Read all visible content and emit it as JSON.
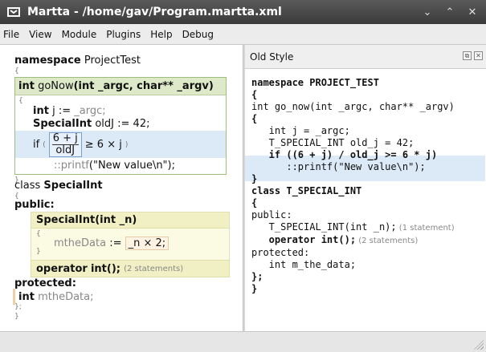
{
  "window": {
    "title": "Martta - /home/gav/Program.martta.xml"
  },
  "menu": [
    "File",
    "View",
    "Module",
    "Plugins",
    "Help",
    "Debug"
  ],
  "left": {
    "namespace_kw": "namespace",
    "namespace_name": "ProjectTest",
    "func": {
      "ret": "int",
      "name": "goNow",
      "params": "(int _argc, char** _argv)"
    },
    "line1": {
      "type": "int",
      "name": "j",
      "op": ":=",
      "value": "_argc;"
    },
    "line2": {
      "type": "SpecialInt",
      "name": "oldJ",
      "op": ":=",
      "value": "42;"
    },
    "line3": {
      "kw": "if",
      "num": "6 + j",
      "den": "oldJ",
      "rest": "≥ 6 × j",
      "close": ")"
    },
    "line4": {
      "call": "::printf",
      "arg": "(\"New value\\n\");"
    },
    "class_kw": "class",
    "class_name": "SpecialInt",
    "public_kw": "public:",
    "ctor": {
      "name": "SpecialInt",
      "params": "(int _n)"
    },
    "assign": {
      "lhs": "mtheData",
      "op": ":=",
      "rhs": "_n × 2;"
    },
    "operator": {
      "kw": "operator",
      "type": "int",
      "paren": "();",
      "note": "(2 statements)"
    },
    "protected_kw": "protected:",
    "field": {
      "type": "int",
      "name": "mtheData;"
    }
  },
  "right": {
    "header": "Old Style",
    "code": [
      "namespace PROJECT_TEST",
      "{",
      "int go_now(int _argc, char** _argv)",
      "{",
      "   int j = _argc;",
      "   T_SPECIAL_INT old_j = 42;",
      "   if ((6 + j) / old_j >= 6 * j)",
      "      ::printf(\"New value\\n\");",
      "}",
      "class T_SPECIAL_INT",
      "{",
      "public:",
      "   T_SPECIAL_INT(int _n);",
      "   operator int();",
      "protected:",
      "   int m_the_data;",
      "};",
      "}"
    ],
    "ctor_note": "(1 statement)",
    "op_note": "(2 statements)"
  }
}
